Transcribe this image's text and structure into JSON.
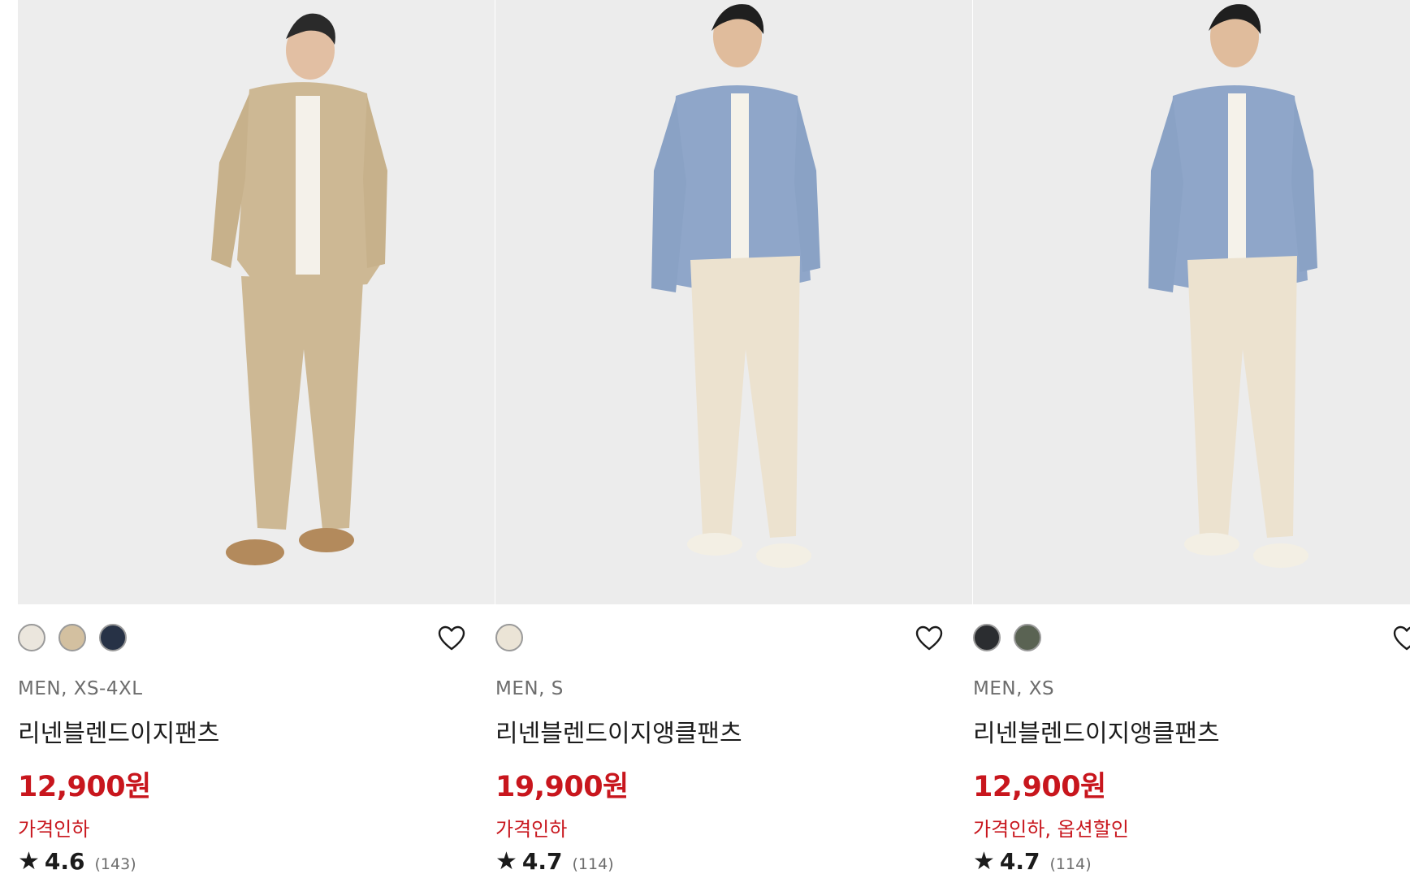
{
  "products": [
    {
      "image_alt": "linen-easy-pants-model",
      "swatches": [
        "#ebe6dd",
        "#d3c0a0",
        "#273246"
      ],
      "meta": "MEN, XS-4XL",
      "name": "리넨블렌드이지팬츠",
      "price": "12,900원",
      "promo": "가격인하",
      "rating": "4.6",
      "review_count": "(143)"
    },
    {
      "image_alt": "linen-easy-ankle-pants-model",
      "swatches": [
        "#ebe4d6"
      ],
      "meta": "MEN, S",
      "name": "리넨블렌드이지앵클팬츠",
      "price": "19,900원",
      "promo": "가격인하",
      "rating": "4.7",
      "review_count": "(114)"
    },
    {
      "image_alt": "linen-easy-ankle-pants-model",
      "swatches": [
        "#2b2d30",
        "#5a6353"
      ],
      "meta": "MEN, XS",
      "name": "리넨블렌드이지앵클팬츠",
      "price": "12,900원",
      "promo": "가격인하, 옵션할인",
      "rating": "4.7",
      "review_count": "(114)"
    }
  ],
  "icons": {
    "favorite": "heart-outline-icon",
    "rating": "star-icon"
  },
  "colors": {
    "price": "#c8161d",
    "text": "#1b1b1b",
    "muted": "#6d6d6d"
  }
}
